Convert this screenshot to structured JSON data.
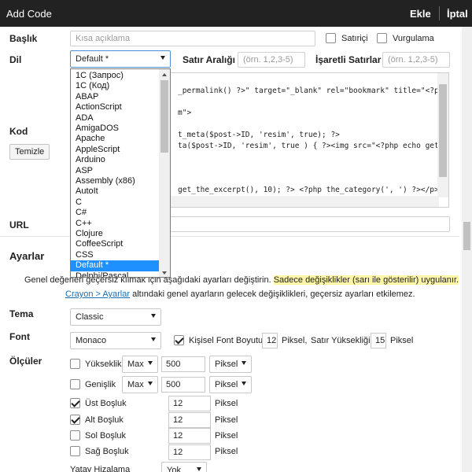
{
  "window": {
    "title": "Add Code",
    "ok_label": "Ekle",
    "cancel_label": "İptal"
  },
  "form": {
    "title_label": "Başlık",
    "title_placeholder": "Kısa açıklama",
    "inline_label": "Satıriçi",
    "highlight_label": "Vurgulama",
    "lang_label": "Dil",
    "lang_value": "Default *",
    "line_range_label": "Satır Aralığı",
    "line_range_placeholder": "(örn. 1,2,3-5)",
    "marked_lines_label": "İşaretli Satırlar",
    "marked_lines_placeholder": "(örn. 1,2,3-5)",
    "code_label": "Kod",
    "clear_button": "Temizle",
    "url_label": "URL"
  },
  "code_lines": [
    "_permalink() ?>\" target=\"_blank\" rel=\"bookmark\" title=\"<?ph",
    "",
    "m\">",
    "",
    "t_meta($post->ID, 'resim', true); ?>",
    "ta($post->ID, 'resim', true ) { ?><img src=\"<?php echo get",
    "",
    "",
    "get_the_excerpt(), 10); ?> <?php the_category(', ') ?></p>"
  ],
  "lang_options": [
    "1C (Запрос)",
    "1C (Код)",
    "ABAP",
    "ActionScript",
    "ADA",
    "AmigaDOS",
    "Apache",
    "AppleScript",
    "Arduino",
    "ASP",
    "Assembly (x86)",
    "AutoIt",
    "C",
    "C#",
    "C++",
    "Clojure",
    "CoffeeScript",
    "CSS",
    "Default *",
    "Delphi/Pascal"
  ],
  "lang_selected_index": 18,
  "settings": {
    "heading": "Ayarlar",
    "notice_pre": "Genel değerleri geçersiz kılmak için aşağıdaki ayarları değiştirin. ",
    "notice_highlight": "Sadece değişiklikler (sarı ile gösterilir) uygulanır.",
    "notice_link": "Crayon > Ayarlar",
    "notice_post": " altındaki genel ayarların gelecek değişiklikleri, geçersiz ayarları etkilemez.",
    "theme_label": "Tema",
    "theme_value": "Classic",
    "font_label": "Font",
    "font_value": "Monaco",
    "custom_font_size_label": "Kişisel Font Boyutu",
    "font_size_value": "12",
    "font_size_unit": "Piksel,",
    "line_height_label": "Satır Yüksekliği",
    "line_height_value": "15",
    "line_height_unit": "Piksel",
    "dimensions_label": "Ölçüler",
    "height_label": "Yükseklik",
    "height_mode": "Max",
    "height_value": "500",
    "height_unit": "Piksel",
    "width_label": "Genişlik",
    "width_mode": "Max",
    "width_value": "500",
    "width_unit": "Piksel",
    "top_margin_label": "Üst Boşluk",
    "top_margin_value": "12",
    "top_margin_unit": "Piksel",
    "bottom_margin_label": "Alt Boşluk",
    "bottom_margin_value": "12",
    "bottom_margin_unit": "Piksel",
    "left_margin_label": "Sol Boşluk",
    "left_margin_value": "12",
    "left_margin_unit": "Piksel",
    "right_margin_label": "Sağ Boşluk",
    "right_margin_value": "12",
    "right_margin_unit": "Piksel",
    "halign_label": "Yatay Hizalama",
    "halign_value": "Yok"
  }
}
